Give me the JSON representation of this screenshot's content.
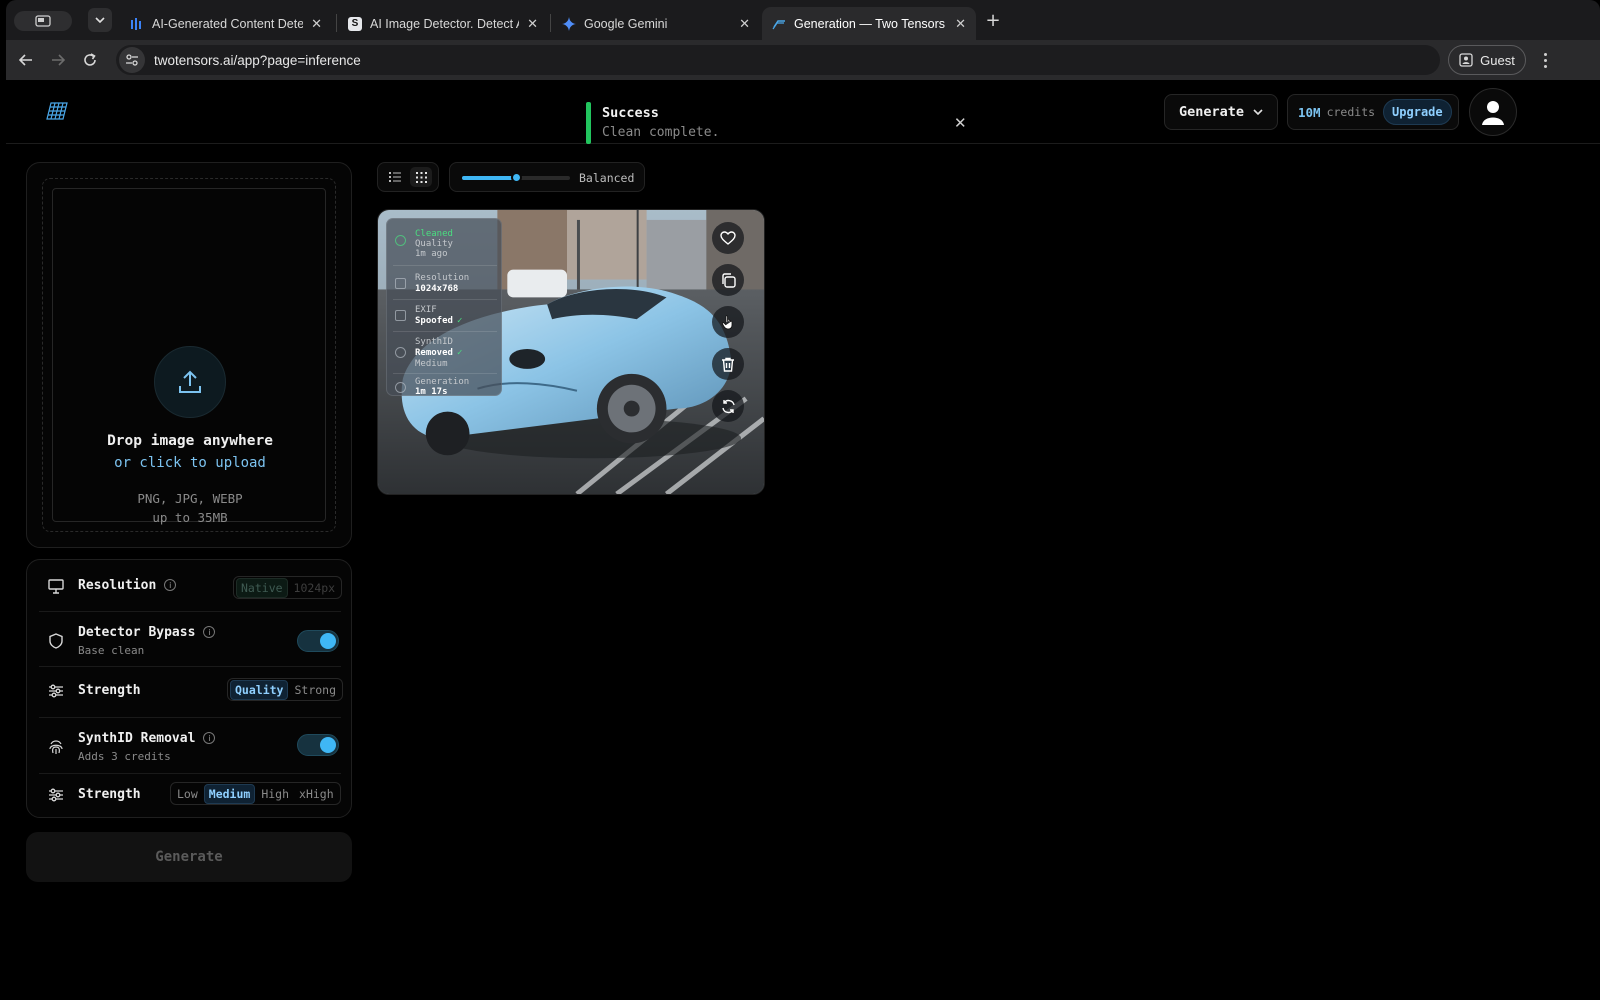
{
  "browser": {
    "tabs": [
      {
        "title": "AI-Generated Content Detect",
        "favicon": "bars-icon"
      },
      {
        "title": "AI Image Detector. Detect AI-",
        "favicon": "s-icon"
      },
      {
        "title": "Google Gemini",
        "favicon": "gemini-icon"
      },
      {
        "title": "Generation — Two Tensors",
        "favicon": "tensors-icon",
        "active": true
      }
    ],
    "url": "twotensors.ai/app?page=inference",
    "profile_label": "Guest"
  },
  "header": {
    "toast": {
      "title": "Success",
      "message": "Clean complete."
    },
    "generate_menu": "Generate",
    "credits_amount": "10M",
    "credits_label": "credits",
    "upgrade_label": "Upgrade"
  },
  "upload": {
    "title": "Drop image anywhere",
    "subtitle": "or click to upload",
    "formats": "PNG, JPG, WEBP",
    "max_size": "up to 35MB"
  },
  "settings": {
    "resolution": {
      "label": "Resolution",
      "options": [
        "Native",
        "1024px"
      ],
      "selected": "Native",
      "disabled": true
    },
    "detector_bypass": {
      "label": "Detector Bypass",
      "sub": "Base clean",
      "enabled": true
    },
    "strength1": {
      "label": "Strength",
      "options": [
        "Quality",
        "Strong"
      ],
      "selected": "Quality"
    },
    "synthid": {
      "label": "SynthID Removal",
      "sub": "Adds 3 credits",
      "enabled": true
    },
    "strength2": {
      "label": "Strength",
      "options": [
        "Low",
        "Medium",
        "High",
        "xHigh"
      ],
      "selected": "Medium"
    },
    "generate_label": "Generate"
  },
  "gallery": {
    "view_mode": "grid",
    "zoom_label": "Balanced",
    "zoom_level": 0.5
  },
  "card": {
    "status": "Cleaned",
    "quality": "Quality",
    "age": "1m ago",
    "resolution_label": "Resolution",
    "resolution_value": "1024x768",
    "exif_label": "EXIF",
    "exif_value": "Spoofed",
    "synthid_label": "SynthID",
    "synthid_value": "Removed",
    "synthid_level": "Medium",
    "generation_label": "Generation",
    "generation_value": "1m 17s",
    "check": "✓"
  },
  "colors": {
    "accent": "#3fb7f5",
    "success": "#22c55e",
    "background": "#000000"
  }
}
